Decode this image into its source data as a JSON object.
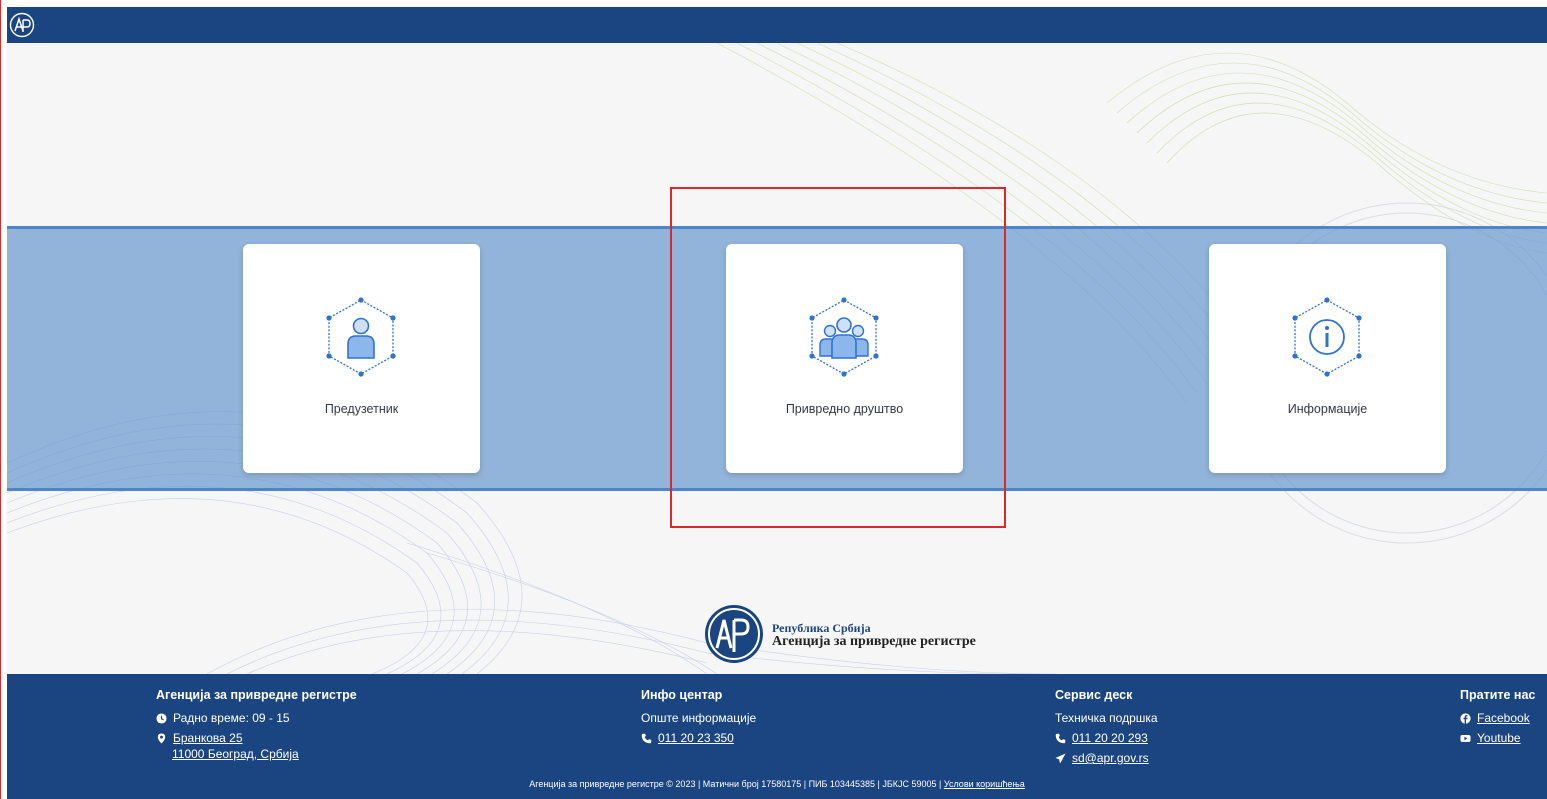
{
  "cards": [
    {
      "label": "Предузетник",
      "icon": "single-person-icon"
    },
    {
      "label": "Привредно друштво",
      "icon": "group-people-icon"
    },
    {
      "label": "Информације",
      "icon": "info-icon"
    }
  ],
  "brand": {
    "logo_text": "АПР",
    "line1": "Република Србија",
    "line2": "Агенција за привредне регистре"
  },
  "footer": {
    "agency": {
      "title": "Агенција за привредне регистре",
      "hours": "Радно време: 09 - 15",
      "address_line1": "Бранкова 25",
      "address_line2": "11000 Београд, Србија"
    },
    "info": {
      "title": "Инфо центар",
      "subtitle": "Опште информације",
      "phone": "011 20 23 350"
    },
    "service": {
      "title": "Сервис деск",
      "subtitle": "Техничка подршка",
      "phone": "011 20 20 293",
      "email": "sd@apr.gov.rs"
    },
    "social": {
      "title": "Пратите нас",
      "facebook": "Facebook",
      "youtube": "Youtube"
    },
    "bottom_text": "Агенција за привредне регистре © 2023 | Матични број 17580175 | ПИБ 103445385 | ЈБКЈС 59005 |",
    "terms_link": "Услови коришћења"
  },
  "colors": {
    "brand_blue": "#1a4580",
    "band_blue": "#8fb4db",
    "icon_blue": "#2e72d2",
    "highlight_red": "#d9292b"
  }
}
